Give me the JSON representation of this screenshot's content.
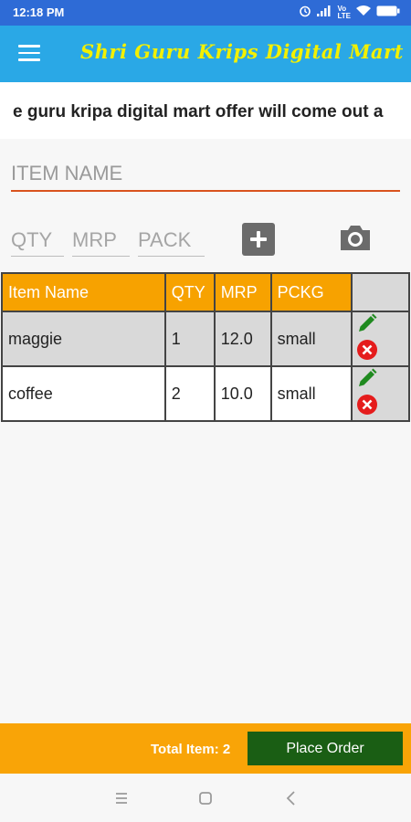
{
  "status_bar": {
    "time": "12:18 PM",
    "icons": [
      "alarm-icon",
      "signal-icon",
      "volte-icon",
      "wifi-icon",
      "battery-icon"
    ],
    "volte_text": "Vo\nLTE"
  },
  "app_bar": {
    "title": "Shri Guru Krips Digital Mart",
    "menu_icon": "menu-icon",
    "title_color": "#f3f000",
    "background": "#2aa8e6"
  },
  "marquee": {
    "text": "e guru kripa digital mart offer will come out a"
  },
  "form": {
    "item_name": {
      "value": "",
      "placeholder": "ITEM NAME"
    },
    "qty": {
      "value": "",
      "placeholder": "QTY"
    },
    "mrp": {
      "value": "",
      "placeholder": "MRP"
    },
    "pack": {
      "value": "",
      "placeholder": "PACK"
    },
    "add_icon": "plus-icon",
    "camera_icon": "camera-icon"
  },
  "table": {
    "headers": [
      "Item Name",
      "QTY",
      "MRP",
      "PCKG"
    ],
    "header_color": "#f7a200",
    "rows": [
      {
        "name": "maggie",
        "qty": "1",
        "mrp": "12.0",
        "pack": "small"
      },
      {
        "name": "coffee",
        "qty": "2",
        "mrp": "10.0",
        "pack": "small"
      }
    ],
    "edit_icon": "pencil-icon",
    "delete_icon": "close-circle-icon",
    "edit_color": "#1f8a1f",
    "delete_color": "#e51c1c"
  },
  "footer": {
    "total_label": "Total Item: 2",
    "place_order_label": "Place Order",
    "background": "#f9a407",
    "button_color": "#1a5e14"
  },
  "nav_bar": {
    "icons": [
      "recents-icon",
      "home-icon",
      "back-icon"
    ]
  }
}
